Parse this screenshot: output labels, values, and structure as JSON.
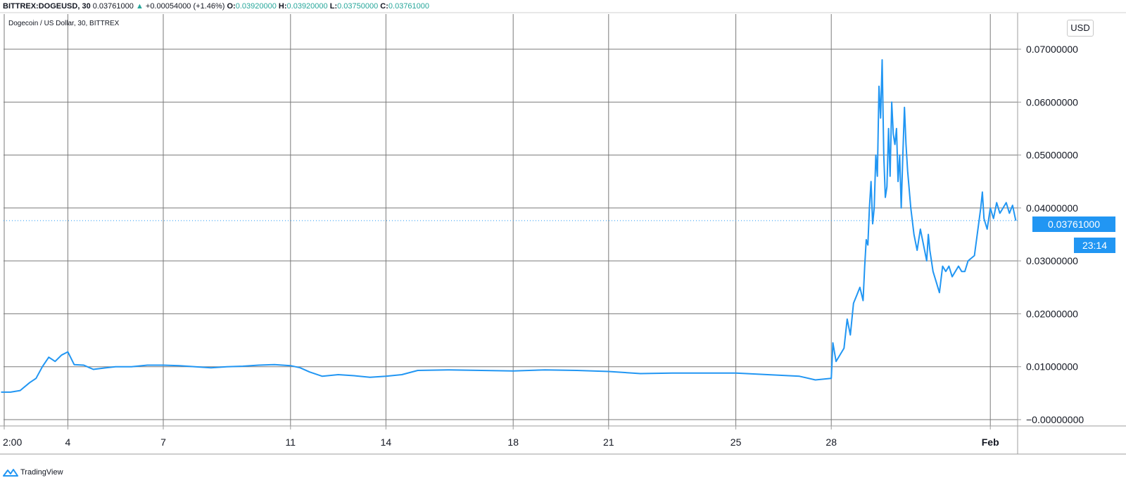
{
  "header": {
    "symbol": "BITTREX:DOGEUSD, 30",
    "last": "0.03761000",
    "change_arrow": "▲",
    "change": "+0.00054000 (+1.46%)",
    "o_label": "O:",
    "o_value": "0.03920000",
    "h_label": "H:",
    "h_value": "0.03920000",
    "l_label": "L:",
    "l_value": "0.03750000",
    "c_label": "C:",
    "c_value": "0.03761000"
  },
  "subtitle": "Dogecoin / US Dollar, 30, BITTREX",
  "currency_button": "USD",
  "price_tag": "0.03761000",
  "countdown_tag": "23:14",
  "footer": {
    "brand": "TradingView",
    "logo_icon": "tradingview-logo-icon"
  },
  "colors": {
    "line": "#2196f3",
    "grid": "#7a7a7a",
    "tag": "#2196f3",
    "up": "#26a69a"
  },
  "chart_data": {
    "type": "line",
    "title": "Dogecoin / US Dollar, 30, BITTREX",
    "xlabel": "",
    "ylabel": "",
    "ylim": [
      -0.002,
      0.077
    ],
    "y_ticks": [
      "−0.00000000",
      "0.01000000",
      "0.02000000",
      "0.03000000",
      "0.04000000",
      "0.05000000",
      "0.06000000",
      "0.07000000"
    ],
    "y_tick_values": [
      0,
      0.01,
      0.02,
      0.03,
      0.04,
      0.05,
      0.06,
      0.07
    ],
    "x_ticks": [
      "2:00",
      "4",
      "7",
      "11",
      "14",
      "18",
      "21",
      "25",
      "28",
      "Feb"
    ],
    "x_tick_values": [
      1,
      3,
      6,
      10,
      13,
      17,
      20,
      24,
      27,
      32
    ],
    "xlim": [
      0.9,
      33
    ],
    "grid": true,
    "last_price": 0.03761,
    "series": [
      {
        "x": [
          0.9,
          1.2,
          1.5,
          1.8,
          2.0,
          2.2,
          2.4,
          2.6,
          2.8,
          3.0,
          3.2,
          3.5,
          3.8,
          4.2,
          4.5,
          5.0,
          5.5,
          6.0,
          6.5,
          7.0,
          7.5,
          8.0,
          8.5,
          9.0,
          9.5,
          10.0,
          10.3,
          10.6,
          11.0,
          11.5,
          12.0,
          12.5,
          13.0,
          13.5,
          14.0,
          15.0,
          16.0,
          17.0,
          18.0,
          19.0,
          20.0,
          21.0,
          22.0,
          23.0,
          24.0,
          25.0,
          26.0,
          26.5,
          27.0,
          27.05,
          27.15,
          27.3,
          27.4,
          27.5,
          27.6,
          27.7,
          27.8,
          27.9,
          28.0,
          28.05,
          28.1,
          28.15,
          28.2,
          28.25,
          28.3,
          28.35,
          28.4,
          28.45,
          28.5,
          28.55,
          28.6,
          28.65,
          28.7,
          28.75,
          28.8,
          28.85,
          28.9,
          28.95,
          29.0,
          29.05,
          29.1,
          29.15,
          29.2,
          29.25,
          29.3,
          29.35,
          29.4,
          29.5,
          29.6,
          29.7,
          29.8,
          29.9,
          30.0,
          30.05,
          30.1,
          30.2,
          30.3,
          30.4,
          30.5,
          30.6,
          30.7,
          30.8,
          30.9,
          31.0,
          31.1,
          31.2,
          31.3,
          31.5,
          31.7,
          31.75,
          31.8,
          31.9,
          32.0,
          32.1,
          32.2,
          32.3,
          32.4,
          32.5,
          32.6,
          32.7,
          32.8
        ],
        "y": [
          0.0052,
          0.0052,
          0.0055,
          0.007,
          0.0078,
          0.01,
          0.0118,
          0.011,
          0.0122,
          0.0128,
          0.0104,
          0.0103,
          0.0095,
          0.0098,
          0.01,
          0.01,
          0.0103,
          0.0103,
          0.0102,
          0.01,
          0.0098,
          0.01,
          0.0101,
          0.0103,
          0.0104,
          0.0102,
          0.0098,
          0.009,
          0.0082,
          0.0085,
          0.0083,
          0.008,
          0.0082,
          0.0085,
          0.0093,
          0.0094,
          0.0093,
          0.0092,
          0.0094,
          0.0093,
          0.0091,
          0.0087,
          0.0088,
          0.0088,
          0.0088,
          0.0085,
          0.0082,
          0.0075,
          0.0078,
          0.0145,
          0.011,
          0.0125,
          0.0135,
          0.019,
          0.016,
          0.022,
          0.0235,
          0.025,
          0.0225,
          0.029,
          0.034,
          0.033,
          0.04,
          0.045,
          0.037,
          0.04,
          0.05,
          0.046,
          0.063,
          0.057,
          0.068,
          0.05,
          0.042,
          0.044,
          0.055,
          0.046,
          0.06,
          0.054,
          0.052,
          0.055,
          0.045,
          0.05,
          0.04,
          0.05,
          0.059,
          0.052,
          0.047,
          0.04,
          0.035,
          0.032,
          0.036,
          0.033,
          0.03,
          0.035,
          0.032,
          0.028,
          0.026,
          0.024,
          0.029,
          0.028,
          0.029,
          0.027,
          0.028,
          0.029,
          0.028,
          0.028,
          0.03,
          0.031,
          0.04,
          0.043,
          0.038,
          0.036,
          0.04,
          0.038,
          0.041,
          0.039,
          0.04,
          0.041,
          0.039,
          0.0405,
          0.0376
        ]
      }
    ]
  }
}
